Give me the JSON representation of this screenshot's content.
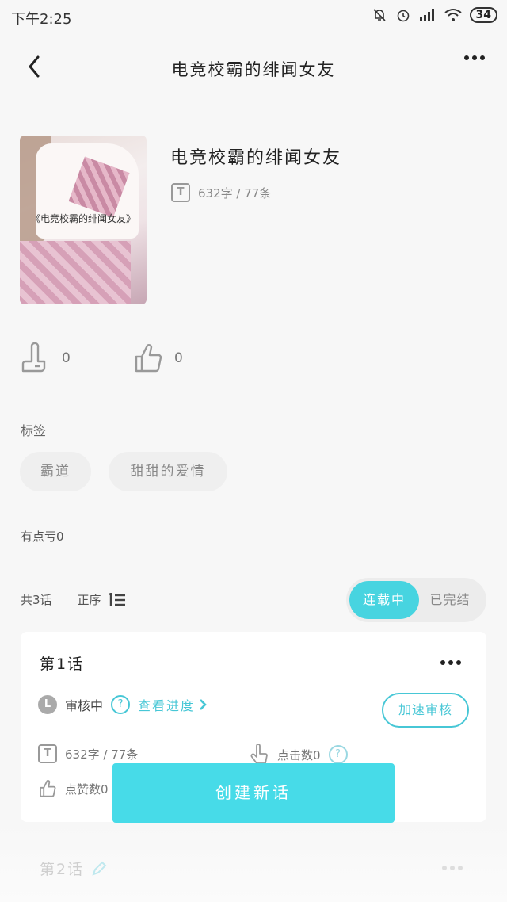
{
  "status_bar": {
    "time": "下午2:25",
    "battery": "34"
  },
  "nav": {
    "title": "电竞校霸的绯闻女友"
  },
  "book": {
    "cover_caption": "《电竞校霸的绯闻女友》",
    "title": "电竞校霸的绯闻女友",
    "meta": "632字 / 77条",
    "t_icon": "T"
  },
  "reactions": {
    "dislike_count": "0",
    "like_count": "0"
  },
  "tags": {
    "label": "标签",
    "items": [
      "霸道",
      "甜甜的爱情"
    ]
  },
  "points_text": "有点亏0",
  "episodes": {
    "count_label": "共3话",
    "sort_label": "正序",
    "toggle": {
      "serializing": "连载中",
      "completed": "已完结"
    }
  },
  "episode_card": {
    "title": "第1话",
    "status_badge": "L",
    "status": "审核中",
    "help": "?",
    "progress_link": "查看进度",
    "speed_button": "加速审核",
    "meta": "632字 / 77条",
    "clicks": "点击数0",
    "likes": "点赞数0"
  },
  "create_button": "创建新话",
  "episode2": {
    "title": "第2话"
  },
  "colors": {
    "accent": "#47d4e0",
    "background": "#f7f7f7"
  }
}
